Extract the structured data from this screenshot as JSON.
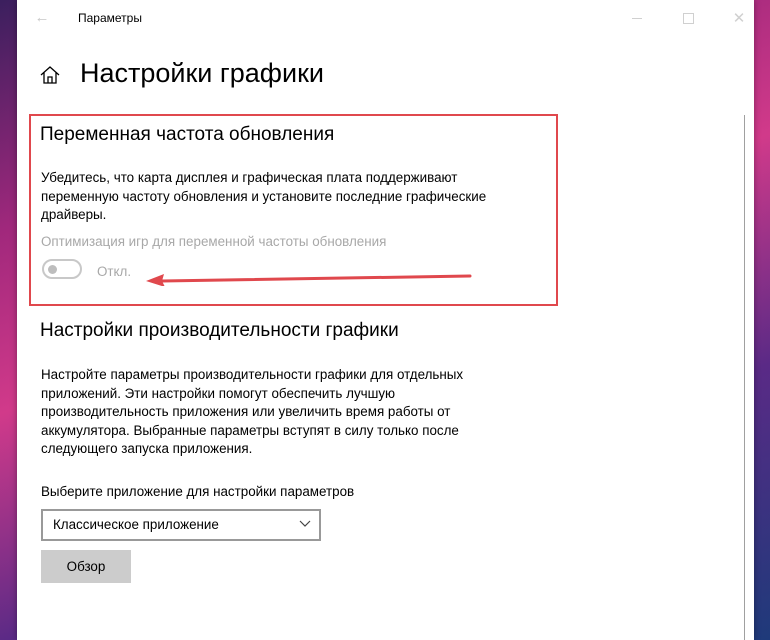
{
  "window": {
    "title": "Параметры",
    "back_icon": "arrow-left-icon",
    "controls": [
      "minimize-icon",
      "maximize-icon",
      "close-icon"
    ]
  },
  "page": {
    "title": "Настройки графики",
    "home_icon": "home-icon"
  },
  "vrr": {
    "title": "Переменная частота обновления",
    "description": "Убедитесь, что карта дисплея и графическая плата поддерживают переменную частоту обновления и установите последние графические драйверы.",
    "toggle_label": "Оптимизация игр для переменной частоты обновления",
    "toggle_state": "Откл.",
    "toggle_on": false
  },
  "performance": {
    "title": "Настройки производительности графики",
    "description": "Настройте параметры производительности графики для отдельных приложений. Эти настройки помогут обеспечить лучшую производительность приложения или увеличить время работы от аккумулятора. Выбранные параметры вступят в силу только после следующего запуска приложения.",
    "select_label": "Выберите приложение для настройки параметров",
    "select_value": "Классическое приложение",
    "browse_label": "Обзор"
  },
  "colors": {
    "annotation_red": "#e0484d",
    "disabled_text": "#a8a8a8",
    "button_bg": "#cccccc"
  }
}
